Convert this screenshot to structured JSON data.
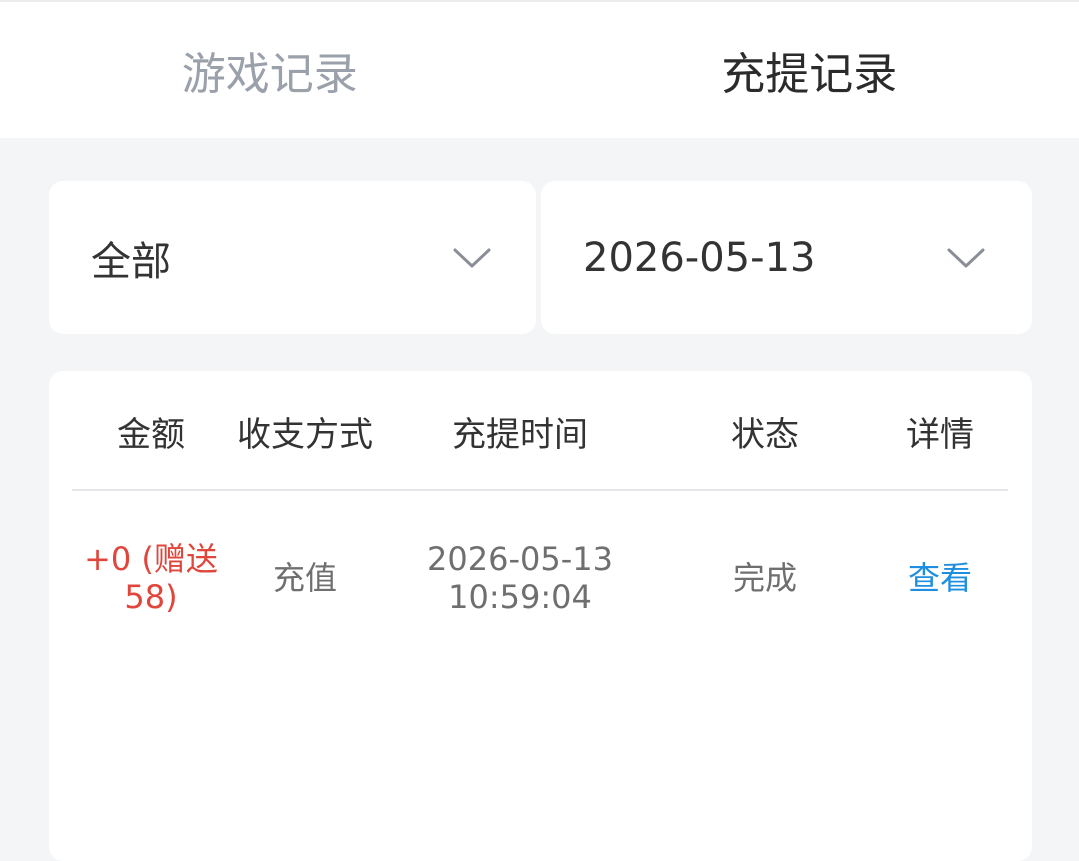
{
  "tabs": [
    {
      "label": "游戏记录",
      "active": false
    },
    {
      "label": "充提记录",
      "active": true
    }
  ],
  "filters": {
    "type": {
      "value": "全部",
      "icon": "chevron-down-icon"
    },
    "date": {
      "value": "2026-05-13",
      "icon": "chevron-down-icon"
    }
  },
  "table": {
    "headers": [
      "金额",
      "收支方式",
      "充提时间",
      "状态",
      "详情"
    ],
    "rows": [
      {
        "amount_line1": "+0 (赠送",
        "amount_line2": "58)",
        "method": "充值",
        "date": "2026-05-13",
        "time": "10:59:04",
        "status": "完成",
        "detail": "查看"
      }
    ]
  },
  "colors": {
    "accent_link": "#1e8fe0",
    "amount_red": "#e0463b",
    "background": "#f4f5f7"
  }
}
